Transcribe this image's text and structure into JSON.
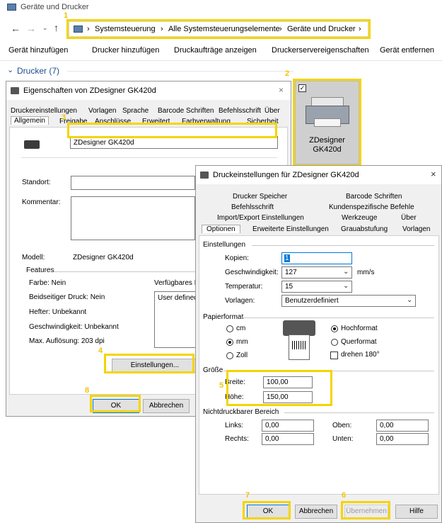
{
  "window": {
    "title": "Geräte und Drucker"
  },
  "address": {
    "crumbs": [
      "Systemsteuerung",
      "Alle Systemsteuerungselemente",
      "Geräte und Drucker"
    ],
    "sep": "›"
  },
  "toolbar": {
    "add_device": "Gerät hinzufügen",
    "add_printer": "Drucker hinzufügen",
    "print_jobs": "Druckaufträge anzeigen",
    "server_props": "Druckerservereigenschaften",
    "remove_device": "Gerät entfernen"
  },
  "printers_header": "Drucker (7)",
  "device": {
    "line1": "ZDesigner",
    "line2": "GK420d"
  },
  "props": {
    "title": "Eigenschaften von ZDesigner GK420d",
    "tabs_row1": [
      "Druckereinstellungen",
      "Vorlagen",
      "Sprache",
      "Barcode Schriften",
      "Befehlsschrift",
      "Über"
    ],
    "tabs_row2": [
      "Allgemein",
      "Freigabe",
      "Anschlüsse",
      "Erweitert",
      "Farbverwaltung",
      "Sicherheit"
    ],
    "printer_name": "ZDesigner GK420d",
    "location_label": "Standort:",
    "comment_label": "Kommentar:",
    "model_label": "Modell:",
    "model_value": "ZDesigner GK420d",
    "features_label": "Features",
    "color": "Farbe: Nein",
    "duplex": "Beidseitiger Druck: Nein",
    "stapler": "Hefter: Unbekannt",
    "speed": "Geschwindigkeit: Unbekannt",
    "resolution": "Max. Auflösung: 203 dpi",
    "available_label": "Verfügbares P",
    "paper_item": "User defined",
    "settings_button": "Einstellungen...",
    "ok": "OK",
    "cancel": "Abbrechen"
  },
  "prefs": {
    "title": "Druckeinstellungen für ZDesigner GK420d",
    "tabs_row1": [
      "Drucker Speicher",
      "Barcode Schriften"
    ],
    "tabs_row2": [
      "Befehlsschrift",
      "Kundenspezifische Befehle"
    ],
    "tabs_row3": [
      "Import/Export Einstellungen",
      "Werkzeuge",
      "Über"
    ],
    "tabs_row4": [
      "Optionen",
      "Erweiterte Einstellungen",
      "Grauabstufung",
      "Vorlagen"
    ],
    "settings_group": "Einstellungen",
    "copies_label": "Kopien:",
    "copies_value": "1",
    "speed_label": "Geschwindigkeit:",
    "speed_value": "127",
    "speed_unit": "mm/s",
    "temp_label": "Temperatur:",
    "temp_value": "15",
    "template_label": "Vorlagen:",
    "template_value": "Benutzerdefiniert",
    "paper_group": "Papierformat",
    "unit_cm": "cm",
    "unit_mm": "mm",
    "unit_inch": "Zoll",
    "portrait": "Hochformat",
    "landscape": "Querformat",
    "rotate": "drehen 180°",
    "size_group": "Größe",
    "width_label": "Breite:",
    "width_value": "100,00",
    "height_label": "Höhe:",
    "height_value": "150,00",
    "nonprint_group": "Nichtdruckbarer Bereich",
    "left_label": "Links:",
    "left_value": "0,00",
    "top_label": "Oben:",
    "top_value": "0,00",
    "right_label": "Rechts:",
    "right_value": "0,00",
    "bottom_label": "Unten:",
    "bottom_value": "0,00",
    "ok": "OK",
    "cancel": "Abbrechen",
    "apply": "Übernehmen",
    "help": "Hilfe"
  },
  "callouts": [
    "1",
    "2",
    "3",
    "4",
    "5",
    "6",
    "7",
    "8"
  ],
  "colors": {
    "highlight": "#f5d400",
    "callout": "#f0c400"
  }
}
